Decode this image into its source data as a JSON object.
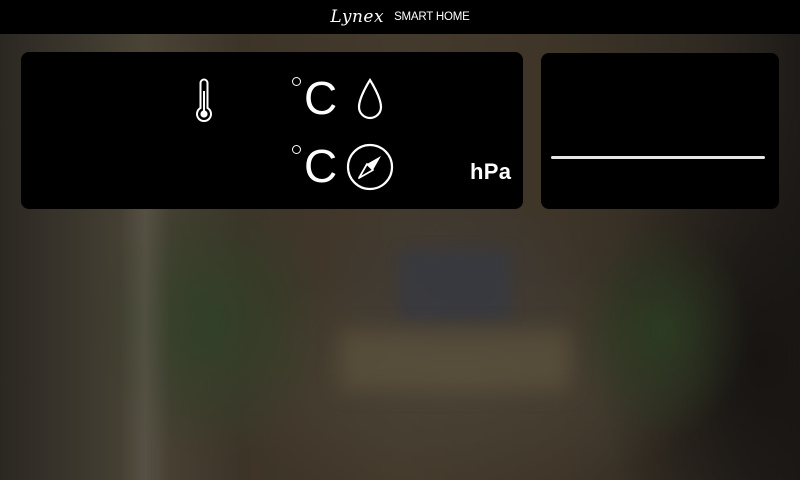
{
  "header": {
    "brand_logo": "Lynex",
    "brand_name": "SMART HOME"
  },
  "weather": {
    "temperature_icon": "thermometer-icon",
    "humidity_icon": "droplet-icon",
    "wind_icon": "compass-icon",
    "temp_unit_top": "C",
    "temp_unit_bottom": "C",
    "pressure_unit": "hPa"
  },
  "colors": {
    "panel_bg": "#000000",
    "text": "#ffffff"
  }
}
